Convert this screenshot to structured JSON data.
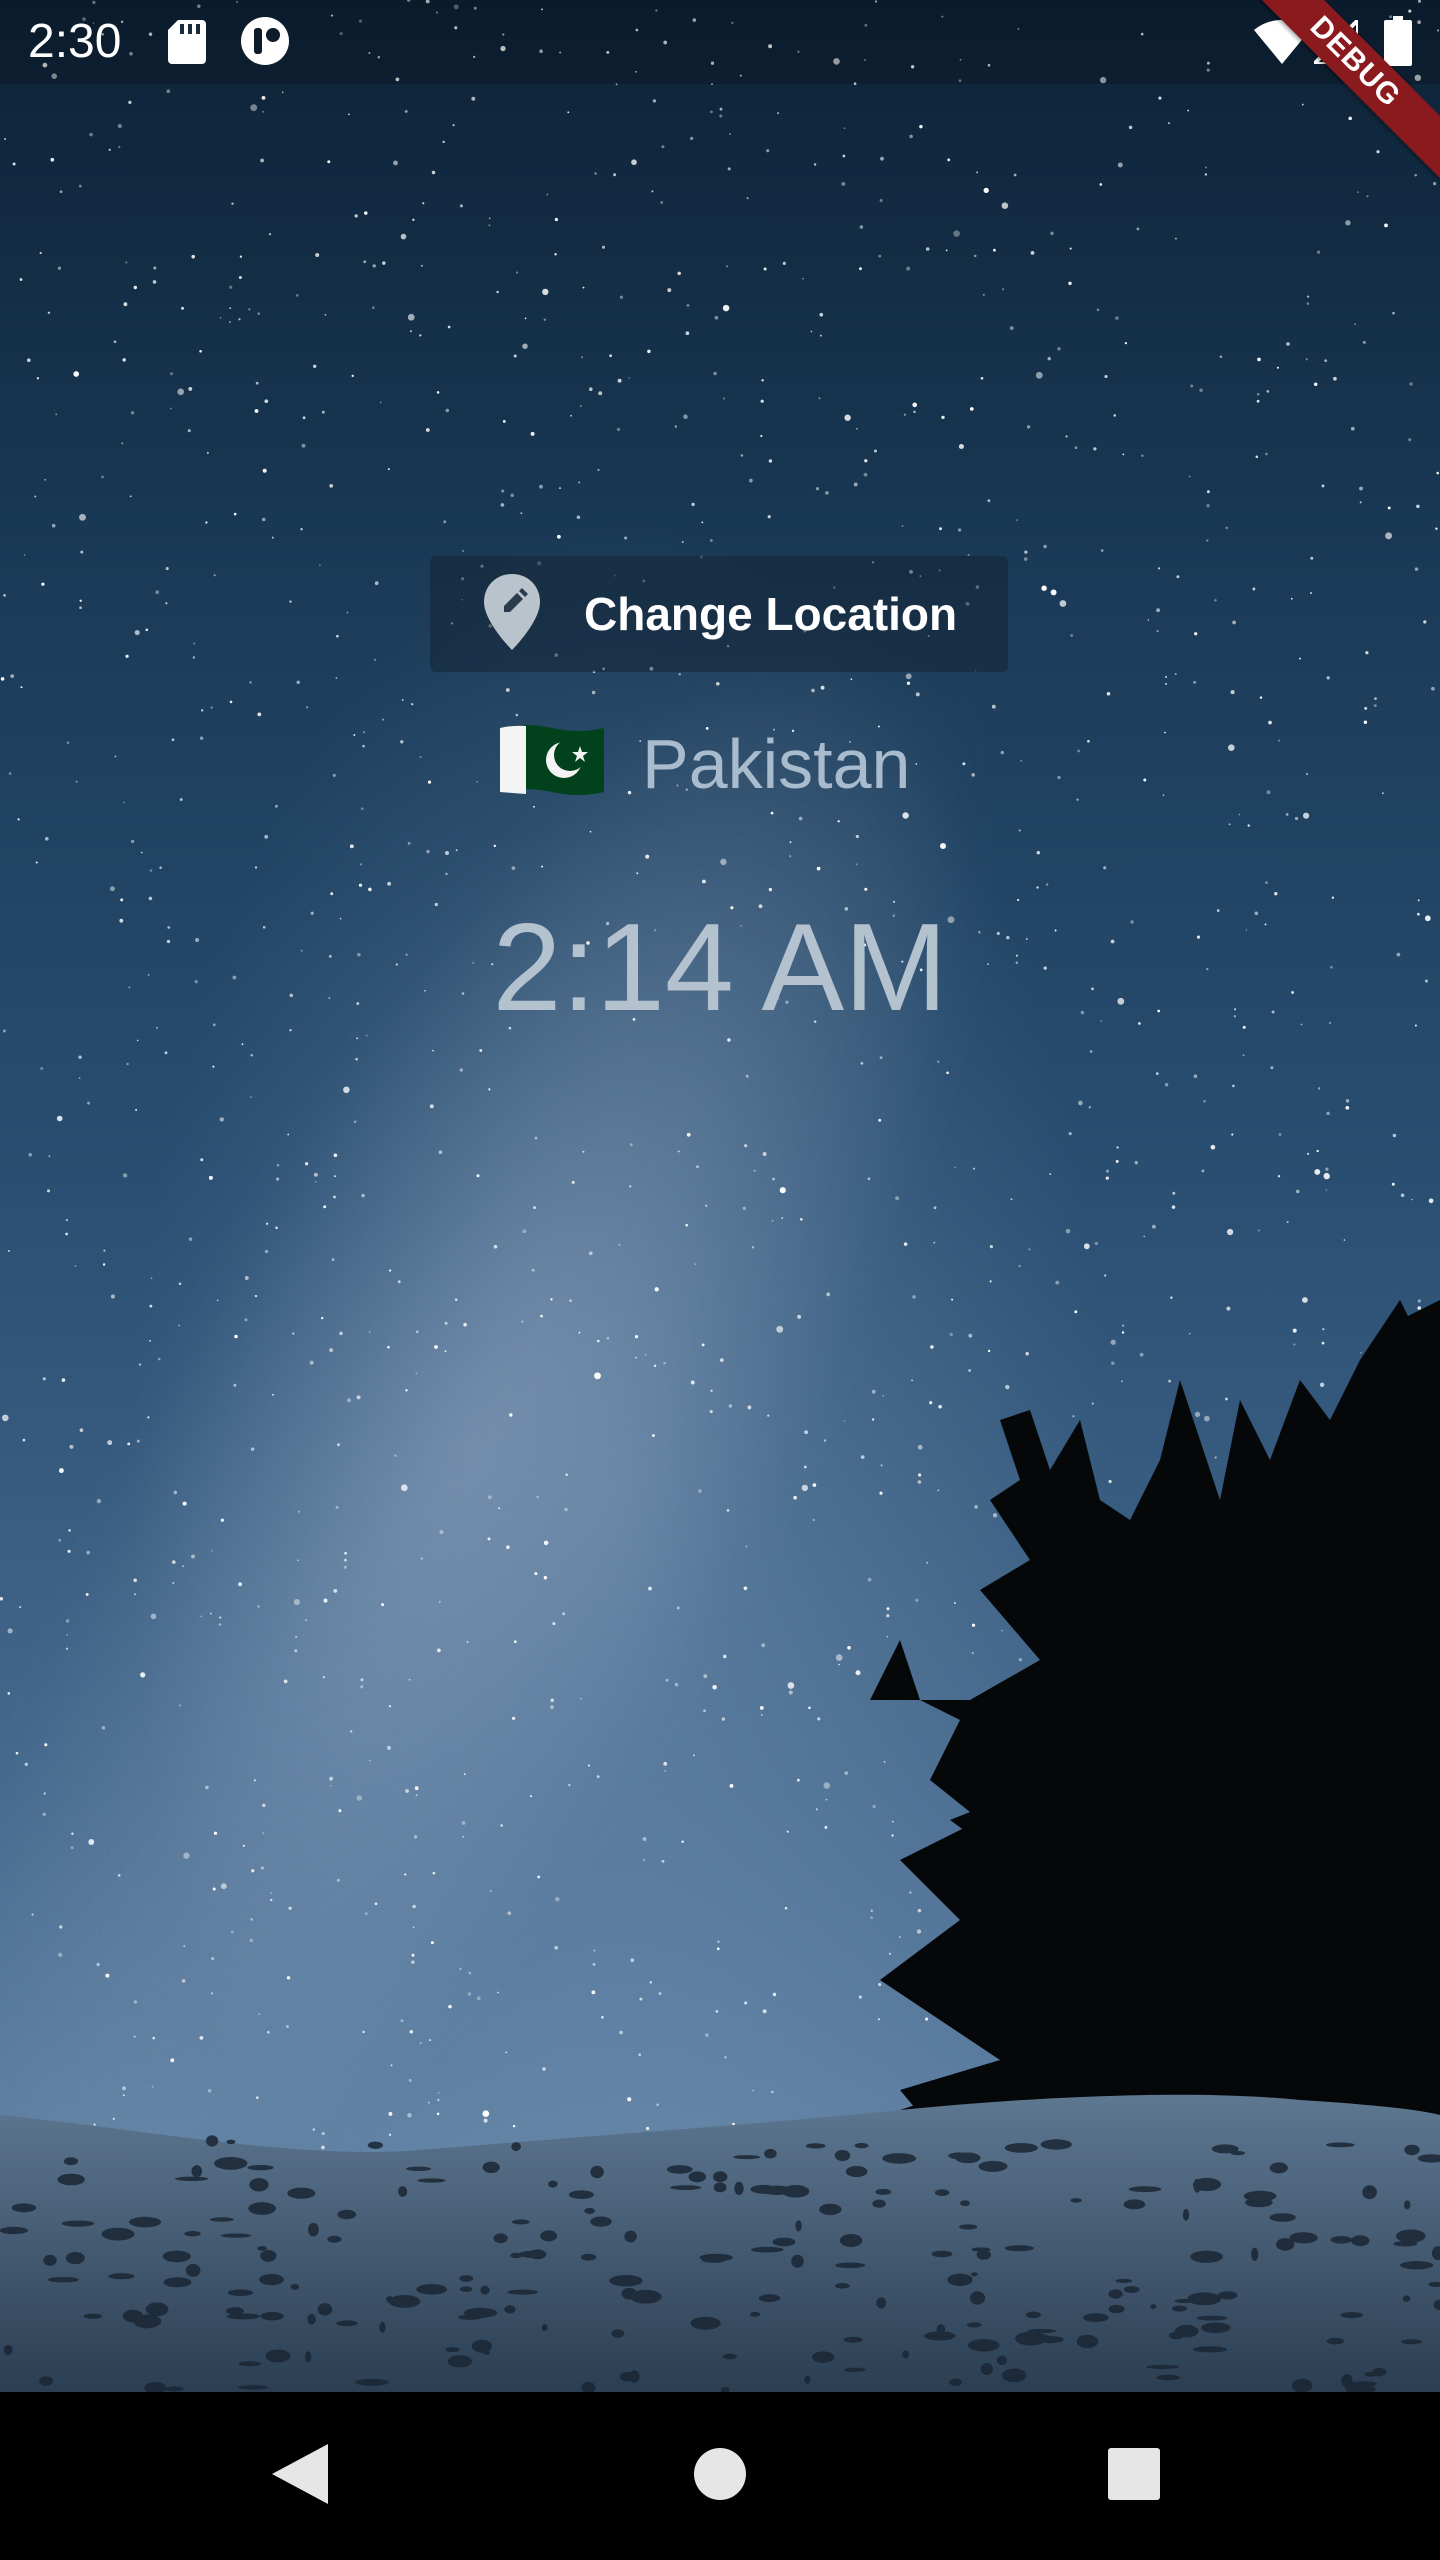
{
  "status_bar": {
    "time": "2:30",
    "icons": [
      "sd-card-icon",
      "vpn-icon",
      "wifi-icon",
      "signal-icon",
      "battery-icon"
    ]
  },
  "debug_banner": {
    "label": "DEBUG",
    "color": "#8b1a1e"
  },
  "location_button": {
    "icon": "edit-location-icon",
    "label": "Change Location"
  },
  "location": {
    "flag_icon": "pakistan-flag-icon",
    "name": "Pakistan"
  },
  "clock": {
    "time": "2:14 AM"
  },
  "nav_bar": {
    "icons": [
      "back-icon",
      "home-icon",
      "recents-icon"
    ]
  },
  "colors": {
    "sky_top": "#0d2236",
    "sky_bottom": "#6f8eaf",
    "location_text": "#a9bccd",
    "clock_text": "#b4c2cf",
    "flag_green": "#01411c"
  }
}
